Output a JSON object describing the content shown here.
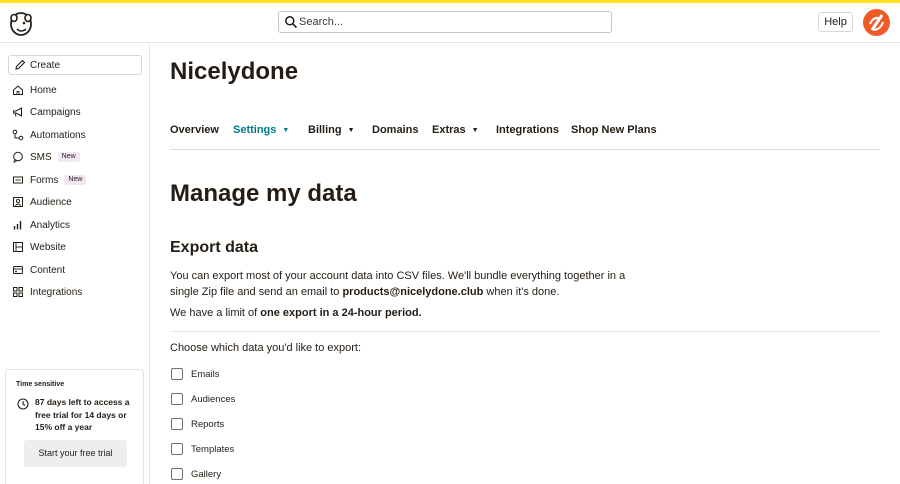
{
  "header": {
    "search_placeholder": "Search...",
    "help_label": "Help",
    "accent_color": "#ffe01b",
    "avatar_color": "#f05a28"
  },
  "sidebar": {
    "create_label": "Create",
    "items": [
      {
        "label": "Home",
        "icon": "home-icon"
      },
      {
        "label": "Campaigns",
        "icon": "megaphone-icon"
      },
      {
        "label": "Automations",
        "icon": "automations-icon"
      },
      {
        "label": "SMS",
        "icon": "sms-icon",
        "badge": "New"
      },
      {
        "label": "Forms",
        "icon": "forms-icon",
        "badge": "New"
      },
      {
        "label": "Audience",
        "icon": "audience-icon"
      },
      {
        "label": "Analytics",
        "icon": "bar-chart-icon"
      },
      {
        "label": "Website",
        "icon": "website-icon"
      },
      {
        "label": "Content",
        "icon": "content-icon"
      },
      {
        "label": "Integrations",
        "icon": "grid-icon"
      }
    ],
    "trial": {
      "heading": "Time sensitive",
      "message": "87 days left to access a free trial for 14 days or 15% off a year",
      "button_label": "Start your free trial"
    }
  },
  "main": {
    "org_name": "Nicelydone",
    "tabs": [
      {
        "label": "Overview"
      },
      {
        "label": "Settings",
        "dropdown": true,
        "active": true
      },
      {
        "label": "Billing",
        "dropdown": true
      },
      {
        "label": "Domains"
      },
      {
        "label": "Extras",
        "dropdown": true
      },
      {
        "label": "Integrations"
      },
      {
        "label": "Shop New Plans"
      }
    ],
    "page_title": "Manage my data",
    "section_title": "Export data",
    "desc_part1": "You can export most of your account data into CSV files. We'll bundle everything together in a single Zip file and send an email to ",
    "desc_email": "products@nicelydone.club",
    "desc_part2": " when it's done.",
    "limit_part1": "We have a limit of ",
    "limit_bold": "one export in a 24-hour period.",
    "choose_label": "Choose which data you'd like to export:",
    "options": [
      "Emails",
      "Audiences",
      "Reports",
      "Templates",
      "Gallery"
    ],
    "active_tab_color": "#007c89"
  }
}
